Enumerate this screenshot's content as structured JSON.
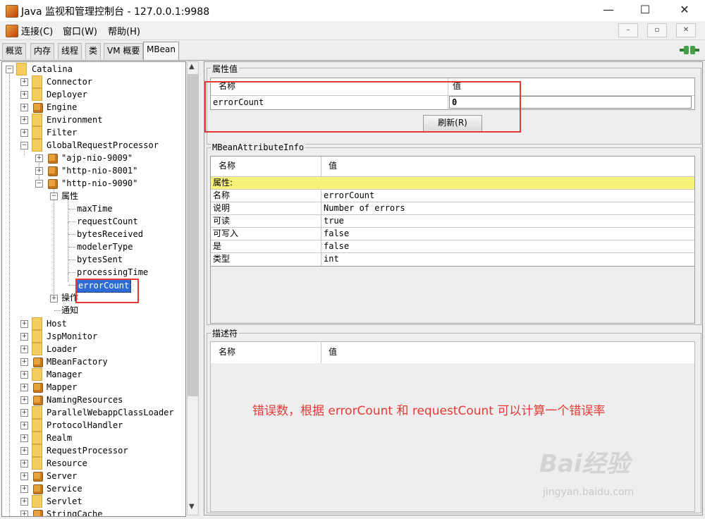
{
  "window": {
    "title": "Java 监视和管理控制台 - 127.0.0.1:9988",
    "minimize": "—",
    "maximize": "☐",
    "close": "✕"
  },
  "menu": {
    "items": [
      "连接(C)",
      "窗口(W)",
      "帮助(H)"
    ],
    "mdi_buttons": [
      "–",
      "▫",
      "✕"
    ]
  },
  "tabs": [
    "概览",
    "内存",
    "线程",
    "类",
    "VM 概要",
    "MBean"
  ],
  "active_tab": "MBean",
  "tree": {
    "root": "Catalina",
    "top_items": [
      "Connector",
      "Deployer",
      "Engine",
      "Environment",
      "Filter",
      "GlobalRequestProcessor"
    ],
    "grp_children": [
      "\"ajp-nio-9009\"",
      "\"http-nio-8001\"",
      "\"http-nio-9090\""
    ],
    "attributes_label": "属性",
    "attributes": [
      "maxTime",
      "requestCount",
      "bytesReceived",
      "modelerType",
      "bytesSent",
      "processingTime",
      "errorCount"
    ],
    "operations_label": "操作",
    "notifications_label": "通知",
    "bottom_items": [
      "Host",
      "JspMonitor",
      "Loader",
      "MBeanFactory",
      "Manager",
      "Mapper",
      "NamingResources",
      "ParallelWebappClassLoader",
      "ProtocolHandler",
      "Realm",
      "RequestProcessor",
      "Resource",
      "Server",
      "Service",
      "Servlet",
      "StringCache"
    ]
  },
  "attr_value": {
    "group_title": "属性值",
    "col_name": "名称",
    "col_value": "值",
    "row_name": "errorCount",
    "row_value": "0",
    "refresh_button": "刷新(R)"
  },
  "attr_info": {
    "group_title": "MBeanAttributeInfo",
    "col_name": "名称",
    "col_value": "值",
    "section_label": "属性:",
    "rows": [
      {
        "k": "名称",
        "v": "errorCount"
      },
      {
        "k": "说明",
        "v": "Number of errors"
      },
      {
        "k": "可读",
        "v": "true"
      },
      {
        "k": "可写入",
        "v": "false"
      },
      {
        "k": "是",
        "v": "false"
      },
      {
        "k": "类型",
        "v": "int"
      }
    ]
  },
  "descriptor": {
    "group_title": "描述符",
    "col_name": "名称",
    "col_value": "值"
  },
  "annotation": "错误数，根据 errorCount 和 requestCount 可以计算一个错误率",
  "watermark": {
    "brand": "Bai经验",
    "url": "jingyan.baidu.com"
  },
  "colors": {
    "highlight_row": "#f7f27a",
    "selection": "#2f6bd6",
    "annotation": "#e53935"
  }
}
